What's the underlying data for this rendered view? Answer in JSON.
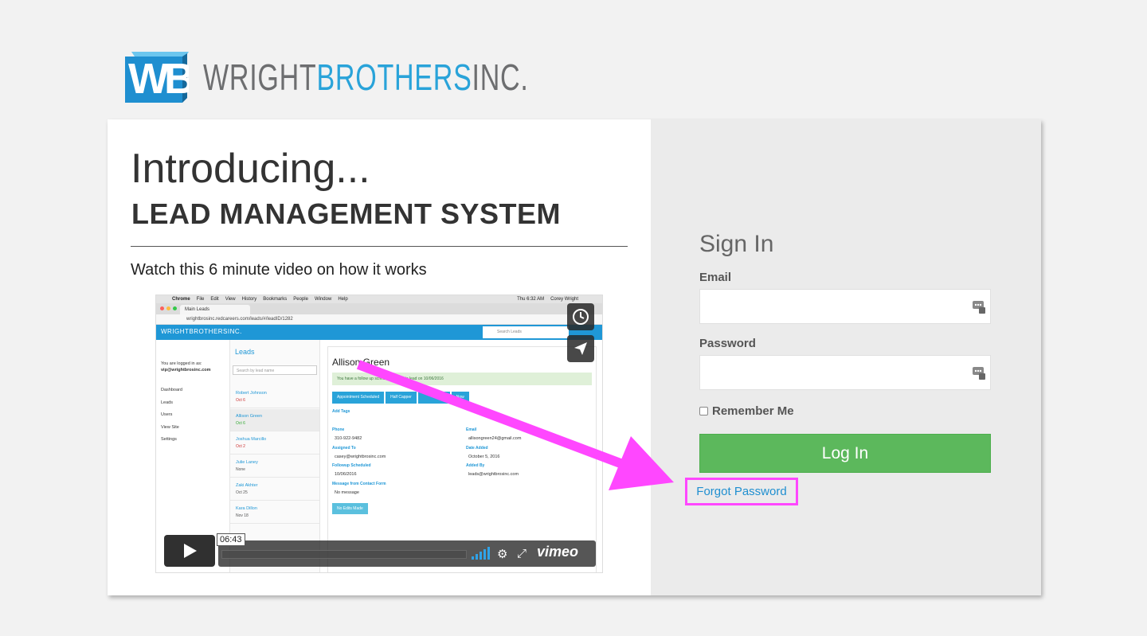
{
  "logo": {
    "word_gray_1": "WRIGHT",
    "word_blue": "BROTHERS",
    "word_gray_2": "INC."
  },
  "intro": {
    "title": "Introducing...",
    "subtitle": "LEAD MANAGEMENT SYSTEM",
    "watch_text": "Watch this 6 minute video on how it works"
  },
  "video": {
    "mac_menu": [
      "Chrome",
      "File",
      "Edit",
      "View",
      "History",
      "Bookmarks",
      "People",
      "Window",
      "Help"
    ],
    "mac_clock": "Thu 6:32 AM",
    "mac_user": "Corey Wright",
    "browser_tab": "Main Leads",
    "address": "wrightbrosinc.redcareers.com/leads/#/leadID/1282",
    "app_brand": "WRIGHTBROTHERSINC.",
    "app_search_placeholder": "Search Leads",
    "logged_in_label": "You are logged in as:",
    "logged_in_user": "vip@wrightbrosinc.com",
    "side_nav": [
      "Dashboard",
      "Leads",
      "Users",
      "View Site",
      "Settings"
    ],
    "leads_title": "Leads",
    "leads_search_placeholder": "Search by lead name",
    "leads": [
      {
        "name": "Robert Johnson",
        "date": "Oct 6"
      },
      {
        "name": "Allison Green",
        "date": "Oct 6"
      },
      {
        "name": "Joshua Marcillo",
        "date": "Oct 2"
      },
      {
        "name": "Julie Laney",
        "date": "None"
      },
      {
        "name": "Zaki Akhter",
        "date": "Oct 25"
      },
      {
        "name": "Kara Dillon",
        "date": "Nov 18"
      }
    ],
    "lead_name": "Allison Green",
    "alert": "You have a follow up scheduled with this lead on 10/06/2016",
    "tags": [
      "Appointment Scheduled",
      "Half Capper",
      "Now"
    ],
    "add_tags": "Add Tags",
    "phone_label": "Phone",
    "phone": "310-922-9482",
    "email_label": "Email",
    "email": "allisongreen24@gmail.com",
    "assigned_label": "Assigned To",
    "assigned": "casey@wrightbrosinc.com",
    "date_added_label": "Date Added",
    "date_added": "October 5, 2016",
    "followup_label": "Followup Scheduled",
    "followup": "10/06/2016",
    "added_by_label": "Added By",
    "added_by": "leads@wrightbrosinc.com",
    "message_label": "Message from Contact Form",
    "message": "No message",
    "edit_button": "No Edits Made",
    "timecode": "06:43",
    "vimeo_label": "vimeo"
  },
  "signin": {
    "title": "Sign In",
    "email_label": "Email",
    "email_value": "",
    "password_label": "Password",
    "password_value": "",
    "remember_label": "Remember Me",
    "login_button": "Log In",
    "forgot_link": "Forgot Password"
  },
  "colors": {
    "brand_blue": "#29a3d9",
    "login_green": "#5cb85c",
    "highlight_magenta": "#ff47ff"
  }
}
